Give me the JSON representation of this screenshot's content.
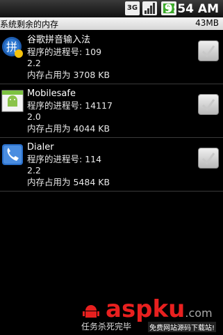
{
  "status_bar": {
    "network": "3G",
    "time": "9:54 AM"
  },
  "summary": {
    "label": "系统剩余的内存",
    "free_memory": "43MB"
  },
  "processes": [
    {
      "name": "谷歌拼音输入法",
      "pid_line": "程序的进程号: 109",
      "version": "2.2",
      "memory_line": "内存占用为 3708 KB",
      "icon": "pinyin-ime-icon",
      "checked": true
    },
    {
      "name": "Mobilesafe",
      "pid_line": "程序的进程号: 14117",
      "version": "2.0",
      "memory_line": "内存占用为 4044 KB",
      "icon": "android-app-icon",
      "checked": true
    },
    {
      "name": "Dialer",
      "pid_line": "程序的进程号: 114",
      "version": "2.2",
      "memory_line": "内存占用为 5484 KB",
      "icon": "phone-dialer-icon",
      "checked": true
    }
  ],
  "footer": {
    "status_text": "任务杀死完毕"
  },
  "watermark": {
    "brand_asp": "asp",
    "brand_ku": "ku",
    "brand_com": ".com",
    "slogan": "免费网站源码下载站!"
  },
  "colors": {
    "summary_bg": "#e2e2e2",
    "background": "#000000",
    "watermark_red": "#e8201f"
  }
}
